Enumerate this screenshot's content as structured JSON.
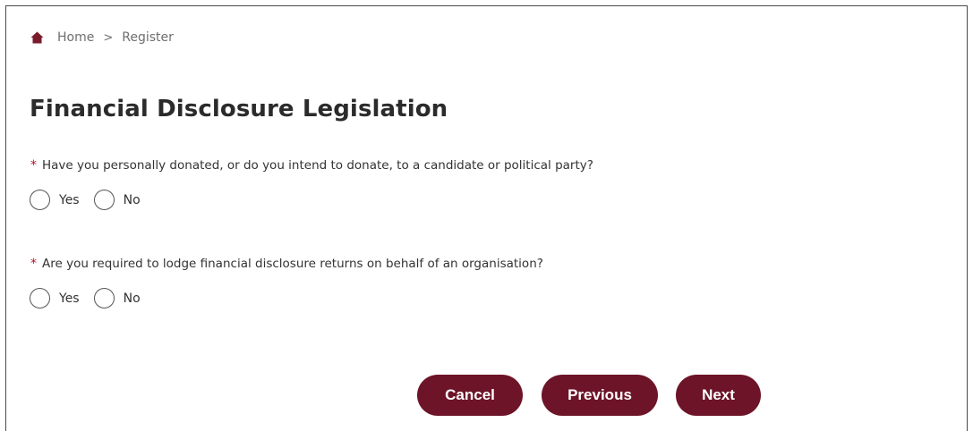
{
  "breadcrumb": {
    "home_icon": "home-icon",
    "items": [
      "Home",
      "Register"
    ],
    "separator": ">"
  },
  "page": {
    "title": "Financial Disclosure Legislation"
  },
  "questions": [
    {
      "required_mark": "*",
      "text": "Have you personally donated, or do you intend to donate, to a candidate or political party?",
      "options": [
        "Yes",
        "No"
      ],
      "selected": null
    },
    {
      "required_mark": "*",
      "text": "Are you required to lodge financial disclosure returns on behalf of an organisation?",
      "options": [
        "Yes",
        "No"
      ],
      "selected": null
    }
  ],
  "buttons": {
    "cancel": "Cancel",
    "previous": "Previous",
    "next": "Next"
  },
  "colors": {
    "accent": "#6d1428",
    "required": "#c0102a",
    "home_icon": "#7a1b2c"
  }
}
